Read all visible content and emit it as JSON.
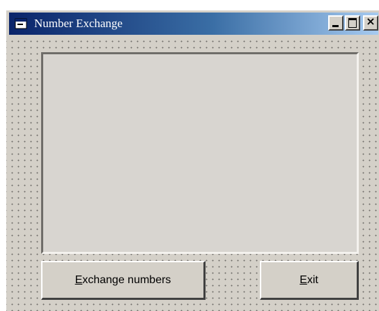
{
  "window": {
    "title": "Number Exchange",
    "app_icon": "vb-form-icon",
    "controls": {
      "minimize_icon": "minimize-icon",
      "maximize_icon": "maximize-icon",
      "close_icon": "close-icon",
      "close_glyph": "×"
    }
  },
  "form": {
    "display_text": "",
    "buttons": {
      "exchange": {
        "access_key": "E",
        "rest": "xchange numbers"
      },
      "exit": {
        "access_key": "E",
        "rest": "xit"
      }
    }
  },
  "colors": {
    "title_gradient_start": "#0a246a",
    "title_gradient_end": "#a6caf0",
    "face": "#d4d0c8"
  }
}
